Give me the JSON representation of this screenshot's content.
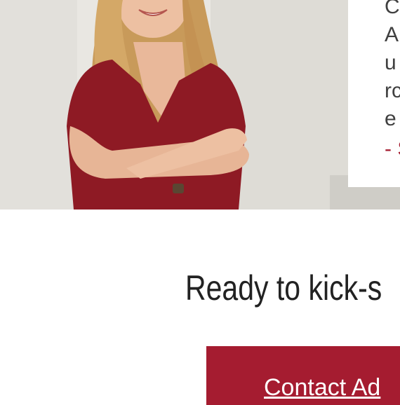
{
  "hero": {
    "photo": "woman-portrait-photo",
    "colors": {
      "dress": "#8e1a24",
      "hair": "#c89a5a",
      "skin": "#e9b89a",
      "wall": "#e8e6e1"
    }
  },
  "testimonial": {
    "lines": [
      "C",
      "A",
      "u",
      "rc",
      "e"
    ],
    "author": "- S"
  },
  "cta": {
    "heading": "Ready to kick-s",
    "button_label": "Contact Ad",
    "accent_color": "#a51c30"
  }
}
